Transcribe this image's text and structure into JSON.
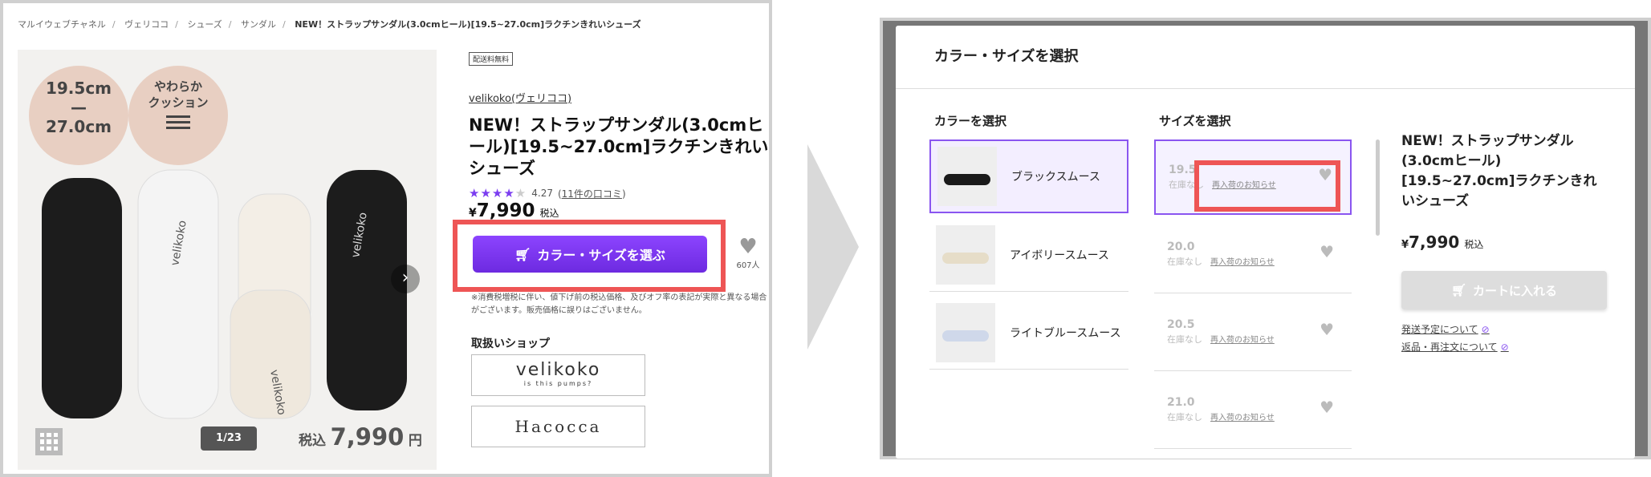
{
  "left": {
    "breadcrumb": [
      "マルイウェブチャネル",
      "ヴェリココ",
      "シューズ",
      "サンダル",
      "NEW！ストラップサンダル(3.0cmヒール)[19.5~27.0cm]ラクチンきれいシューズ"
    ],
    "breadcrumb_sep": "/",
    "image": {
      "badge_size_line1": "19.5cm",
      "badge_size_line2": "—",
      "badge_size_line3": "27.0cm",
      "badge_cushion_line1": "やわらか",
      "badge_cushion_line2": "クッション",
      "next_icon": "chevron-right-icon",
      "pager": "1/23",
      "price_tax": "税込",
      "price_amount": "7,990",
      "price_yen": "円",
      "shoe_brand_text": "velikoko"
    },
    "badge": "配送料無料",
    "brand": "velikoko(ヴェリココ)",
    "title": "NEW！ストラップサンダル(3.0cmヒール)[19.5~27.0cm]ラクチンきれいシューズ",
    "rating": {
      "stars": "★★★★",
      "star_off": "★",
      "score": "4.27",
      "reviews_prefix": "(",
      "reviews": "11件の口コミ",
      "reviews_suffix": ")",
      "value": 4.27,
      "max": 5
    },
    "price": {
      "yen": "¥",
      "amount": "7,990",
      "tax": "税込"
    },
    "cta": "カラー・サイズを選ぶ",
    "favorite_count": "607人",
    "note": "※消費税増税に伴い、値下げ前の税込価格、及びオフ率の表記が実際と異なる場合がございます。販売価格に誤りはございません。",
    "shop_heading": "取扱いショップ",
    "shops": [
      {
        "name": "velikoko",
        "tagline": "is this pumps?"
      },
      {
        "name": "Hacocca"
      }
    ]
  },
  "right": {
    "modal_title": "カラー・サイズを選択",
    "color_heading": "カラーを選択",
    "size_heading": "サイズを選択",
    "colors": [
      {
        "name": "ブラックスムース",
        "swatch": "#1a1a1a"
      },
      {
        "name": "アイボリースムース",
        "swatch": "#f1ece0"
      },
      {
        "name": "ライトブルースムース",
        "swatch": "#dfe6f2"
      }
    ],
    "sizes": [
      {
        "size": "19.5",
        "stock": "在庫なし",
        "restock": "再入荷のお知らせ"
      },
      {
        "size": "20.0",
        "stock": "在庫なし",
        "restock": "再入荷のお知らせ"
      },
      {
        "size": "20.5",
        "stock": "在庫なし",
        "restock": "再入荷のお知らせ"
      },
      {
        "size": "21.0",
        "stock": "在庫なし",
        "restock": "再入荷のお知らせ"
      }
    ],
    "product_title": "NEW！ストラップサンダル(3.0cmヒール)[19.5~27.0cm]ラクチンきれいシューズ",
    "price": {
      "yen": "¥",
      "amount": "7,990",
      "tax": "税込"
    },
    "cart_button": "カートに入れる",
    "links": [
      "発送予定について",
      "返品・再注文について"
    ]
  },
  "colors": {
    "accent": "#7b3df0",
    "highlight": "#ee5555",
    "selected_border": "#8a55f0"
  }
}
